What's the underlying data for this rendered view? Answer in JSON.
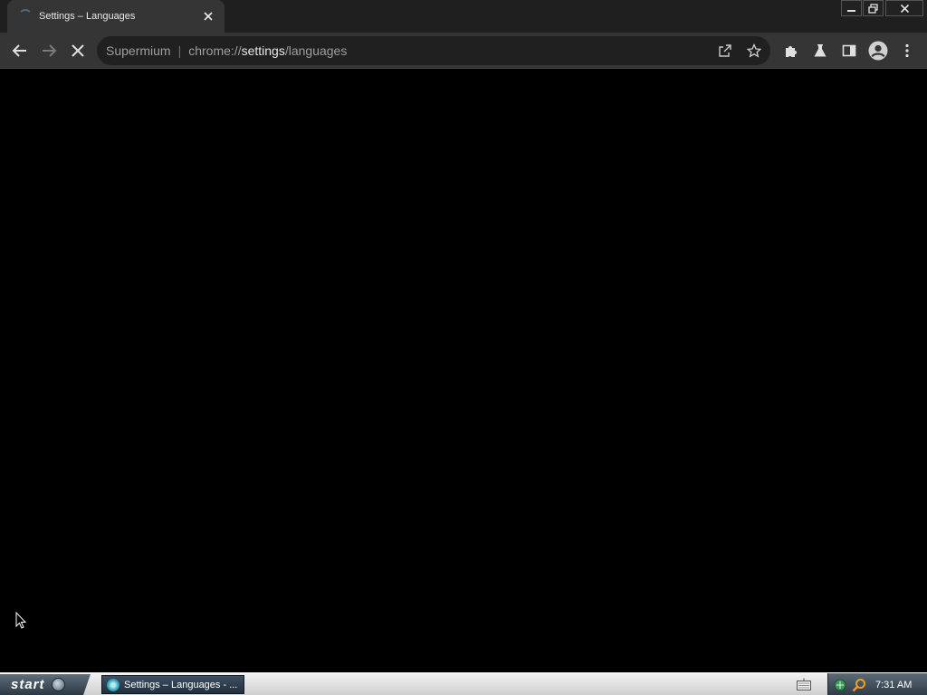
{
  "browser": {
    "tab": {
      "title": "Settings – Languages",
      "close_glyph": "✕",
      "favicon": "loading-spinner-icon"
    },
    "window_controls": [
      "minimize-icon",
      "restore-icon",
      "close-icon"
    ],
    "toolbar": {
      "back_icon": "arrow-left-icon",
      "forward_icon": "arrow-right-icon",
      "stop_icon": "stop-loading-icon"
    },
    "omnibox": {
      "site_chip": "Supermium",
      "separator": "|",
      "url_prefix": "chrome://",
      "url_host": "settings",
      "url_path": "/languages",
      "actions": [
        "share-icon",
        "bookmark-star-icon"
      ]
    },
    "extensions": [
      "puzzle-extensions-icon",
      "flask-labs-icon",
      "side-panel-icon",
      "profile-avatar-icon",
      "kebab-menu-icon"
    ]
  },
  "taskbar": {
    "start_label": "start",
    "task_label": "Settings – Languages - ...",
    "clock": "7:31 AM",
    "tray_icons": [
      "network-icon",
      "search-icon"
    ]
  },
  "colors": {
    "frame": "#1f1f1f",
    "toolbar": "#353535",
    "omnibox": "#202020",
    "page": "#000000",
    "taskbar": "#d9d9d9",
    "tray": "#3b4853"
  }
}
